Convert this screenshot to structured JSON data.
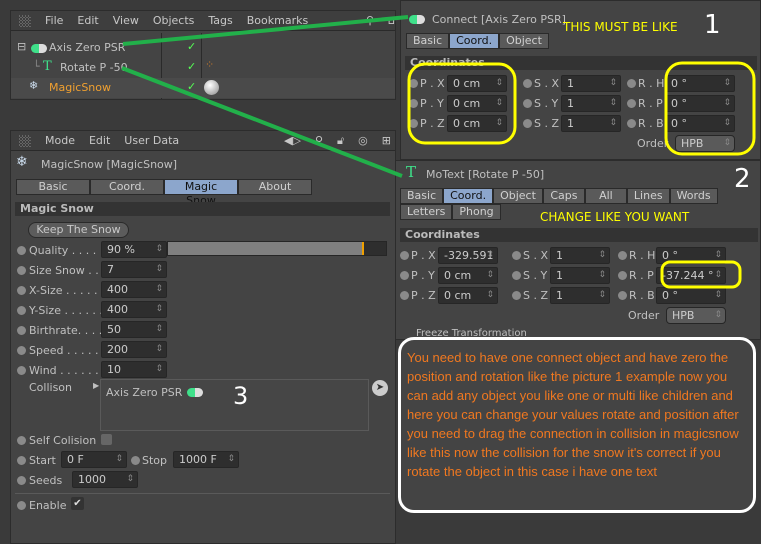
{
  "object_manager": {
    "menu": [
      "File",
      "Edit",
      "View",
      "Objects",
      "Tags",
      "Bookmarks"
    ],
    "objects": [
      {
        "name": "Axis Zero PSR",
        "icon": "connect-icon"
      },
      {
        "name": "Rotate P -50",
        "icon": "motext-icon"
      },
      {
        "name": "MagicSnow",
        "icon": "snowflake-icon",
        "color": "#f0a030"
      }
    ]
  },
  "attributes": {
    "menu": [
      "Mode",
      "Edit",
      "User Data"
    ],
    "title": "MagicSnow [MagicSnow]",
    "tabs": [
      "Basic",
      "Coord.",
      "Magic Snow",
      "About"
    ],
    "active_tab": "Magic Snow",
    "section": "Magic Snow",
    "keep_button": "Keep The Snow",
    "params": [
      {
        "label": "Quality . . . .",
        "value": "90 %"
      },
      {
        "label": "Size Snow . .",
        "value": "7"
      },
      {
        "label": "X-Size . . . . . .",
        "value": "400"
      },
      {
        "label": "Y-Size . . . . . .",
        "value": "400"
      },
      {
        "label": "Birthrate. . . .",
        "value": "50"
      },
      {
        "label": "Speed . . . . .",
        "value": "200"
      },
      {
        "label": "Wind . . . . . .",
        "value": "10"
      }
    ],
    "quality_slider_percent": 90,
    "collision_label": "Collison",
    "collision_item": "Axis Zero PSR",
    "self_collision_label": "Self Colision",
    "self_collision": false,
    "start_label": "Start",
    "start": "0 F",
    "stop_label": "Stop",
    "stop": "1000 F",
    "seeds_label": "Seeds",
    "seeds": "1000",
    "enable_label": "Enable",
    "enable": true
  },
  "connect_panel": {
    "title": "Connect [Axis Zero PSR]",
    "tabs": [
      "Basic",
      "Coord.",
      "Object"
    ],
    "section": "Coordinates",
    "rows": [
      [
        "P . X",
        "0 cm",
        "S . X",
        "1",
        "R . H",
        "0 °"
      ],
      [
        "P . Y",
        "0 cm",
        "S . Y",
        "1",
        "R . P",
        "0 °"
      ],
      [
        "P . Z",
        "0 cm",
        "S . Z",
        "1",
        "R . B",
        "0 °"
      ]
    ],
    "order_label": "Order",
    "order": "HPB"
  },
  "motext_panel": {
    "title": "MoText [Rotate P -50]",
    "tabs": [
      "Basic",
      "Coord.",
      "Object",
      "Caps",
      "All",
      "Lines",
      "Words",
      "Letters",
      "Phong"
    ],
    "section": "Coordinates",
    "rows": [
      [
        "P . X",
        "-329.591 c",
        "S . X",
        "1",
        "R . H",
        "0 °"
      ],
      [
        "P . Y",
        "0 cm",
        "S . Y",
        "1",
        "R . P",
        "-37.244 °"
      ],
      [
        "P . Z",
        "0 cm",
        "S . Z",
        "1",
        "R . B",
        "0 °"
      ]
    ],
    "order_label": "Order",
    "order": "HPB",
    "freeze": "Freeze Transformation"
  },
  "annotations": {
    "must_be": "THIS MUST BE LIKE",
    "n1": "1",
    "n2": "2",
    "n3": "3",
    "change": "CHANGE LIKE YOU WANT",
    "note": "You need to have one connect object and have zero the position and rotation like the picture 1  example now you can add any object you like one or multi like children and here you can change your values rotate and position after you need to drag the connection in collision in magicsnow like this now the collision for the snow it's correct if you rotate the object in this case i have one text",
    "colors": {
      "highlight": "#ffff00",
      "connector": "#22b04a",
      "note_text": "#f07820"
    }
  }
}
